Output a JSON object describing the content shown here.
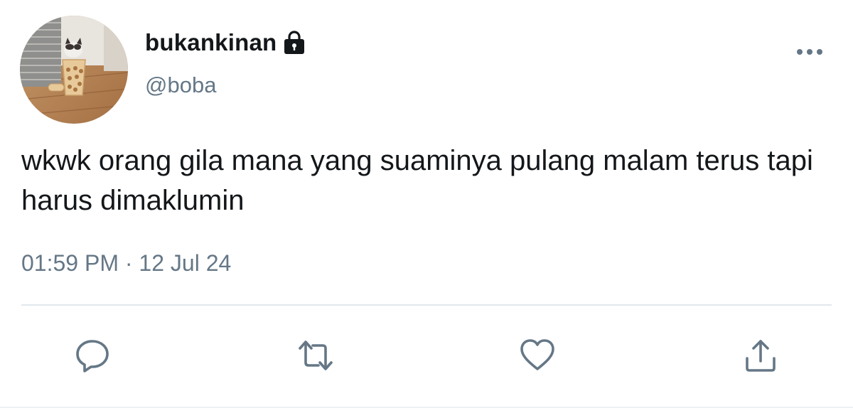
{
  "tweet": {
    "display_name": "bukankinan",
    "handle": "@boba",
    "text": "wkwk orang gila mana yang suaminya pulang malam terus tapi harus dimaklumin",
    "time": "01:59 PM",
    "separator": "·",
    "date": "12 Jul 24",
    "protected_icon": "lock-icon",
    "avatar_icon": "profile-photo-cat-with-bubble-tea"
  },
  "actions": {
    "reply_icon": "reply-icon",
    "retweet_icon": "retweet-icon",
    "like_icon": "heart-icon",
    "share_icon": "share-icon",
    "more_icon": "more-dots-icon"
  },
  "colors": {
    "text_primary": "#14171a",
    "text_secondary": "#657786",
    "icon": "#657786",
    "divider": "#e1e8ed"
  }
}
